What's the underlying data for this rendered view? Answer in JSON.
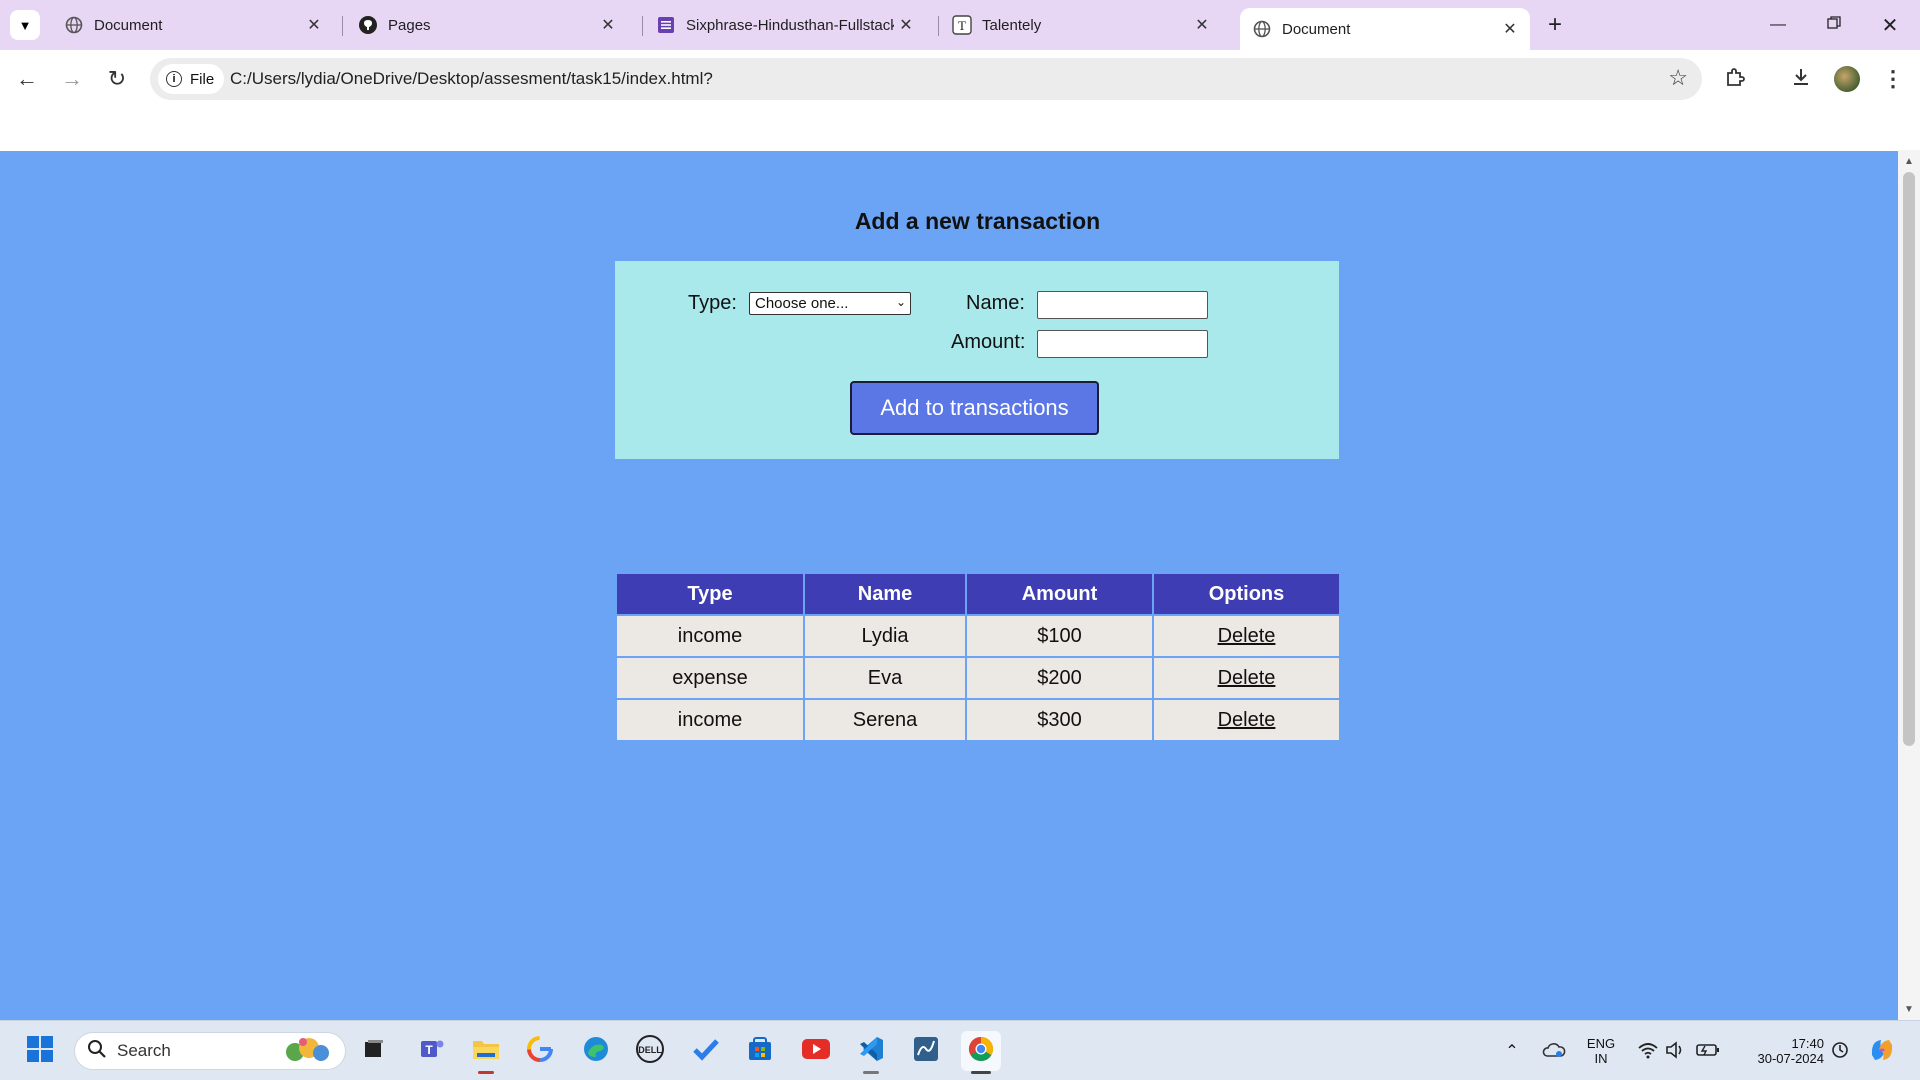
{
  "browser": {
    "tabs": [
      {
        "title": "Document",
        "icon": "globe-icon"
      },
      {
        "title": "Pages",
        "icon": "github-icon"
      },
      {
        "title": "Sixphrase-Hindusthan-Fullstack",
        "icon": "form-icon"
      },
      {
        "title": "Talentely",
        "icon": "talentely-icon"
      },
      {
        "title": "Document",
        "icon": "globe-icon",
        "active": true
      }
    ],
    "security_chip": "File",
    "url": "C:/Users/lydia/OneDrive/Desktop/assesment/task15/index.html?"
  },
  "page": {
    "heading": "Add a new transaction",
    "form": {
      "type_label": "Type:",
      "type_selected": "Choose one...",
      "name_label": "Name:",
      "amount_label": "Amount:",
      "name_value": "",
      "amount_value": "",
      "submit_label": "Add to transactions"
    },
    "table": {
      "headers": [
        "Type",
        "Name",
        "Amount",
        "Options"
      ],
      "rows": [
        {
          "type": "income",
          "name": "Lydia",
          "amount": "$100",
          "option": "Delete"
        },
        {
          "type": "expense",
          "name": "Eva",
          "amount": "$200",
          "option": "Delete"
        },
        {
          "type": "income",
          "name": "Serena",
          "amount": "$300",
          "option": "Delete"
        }
      ]
    },
    "colors": {
      "background": "#6ba4f4",
      "form_background": "#a9e9eb",
      "button": "#5b77e6",
      "table_header": "#3e3db4",
      "table_cell": "#ece9e5"
    }
  },
  "taskbar": {
    "search_placeholder": "Search",
    "language": "ENG",
    "region": "IN",
    "time": "17:40",
    "date": "30-07-2024"
  }
}
